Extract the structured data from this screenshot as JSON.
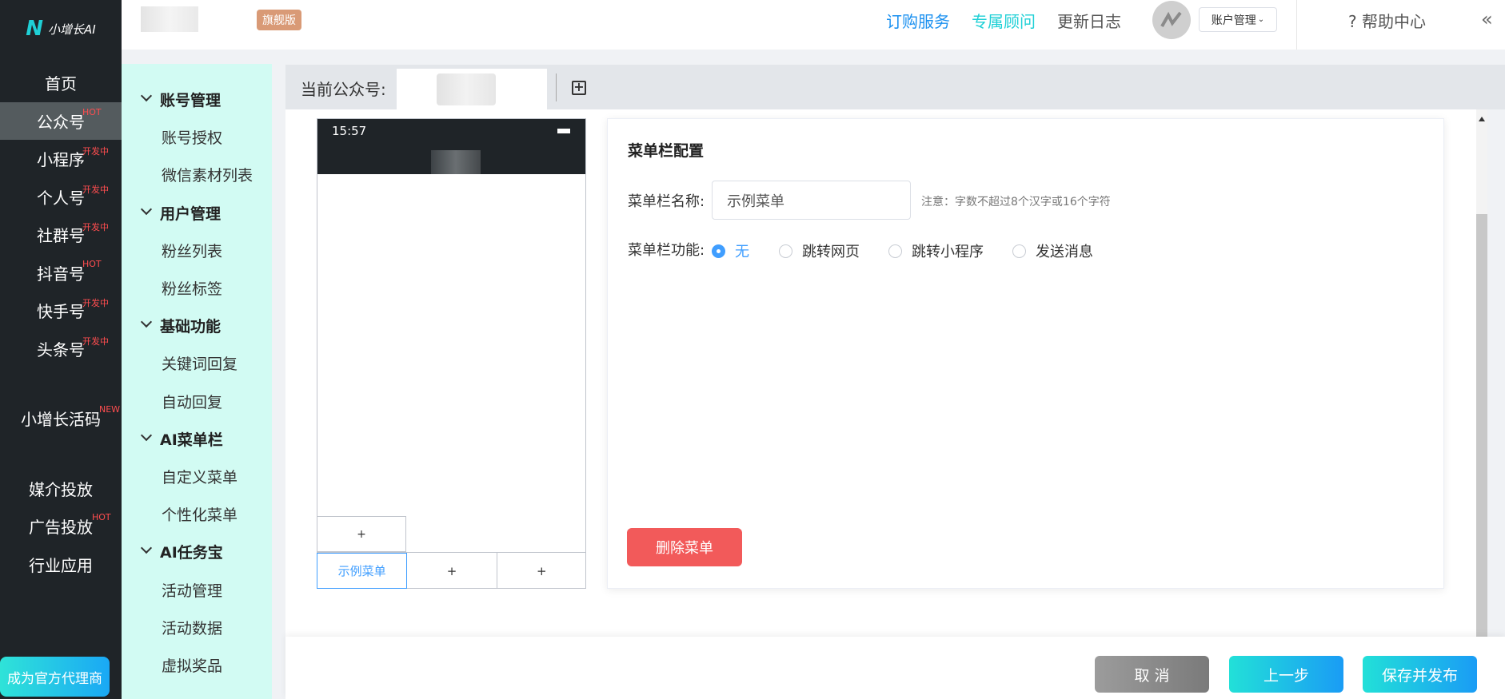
{
  "brand": {
    "logo_text": "小增长AI"
  },
  "sidebar": {
    "items": [
      {
        "label": "首页",
        "tag": ""
      },
      {
        "label": "公众号",
        "tag": "HOT"
      },
      {
        "label": "小程序",
        "tag": "开发中"
      },
      {
        "label": "个人号",
        "tag": "开发中"
      },
      {
        "label": "社群号",
        "tag": "开发中"
      },
      {
        "label": "抖音号",
        "tag": "HOT"
      },
      {
        "label": "快手号",
        "tag": "开发中"
      },
      {
        "label": "头条号",
        "tag": "开发中"
      }
    ],
    "live_code": {
      "label": "小增长活码",
      "tag": "NEW"
    },
    "extra": [
      {
        "label": "媒介投放",
        "tag": ""
      },
      {
        "label": "广告投放",
        "tag": "HOT"
      },
      {
        "label": "行业应用",
        "tag": ""
      }
    ],
    "agent_button": "成为官方代理商"
  },
  "header": {
    "edition_badge": "旗舰版",
    "links": {
      "subscribe": "订购服务",
      "advisor": "专属顾问",
      "changelog": "更新日志"
    },
    "account_menu": "账户管理",
    "help": "帮助中心",
    "collapse_icon": "«"
  },
  "submenu": {
    "groups": [
      {
        "title": "账号管理",
        "items": [
          "账号授权",
          "微信素材列表"
        ]
      },
      {
        "title": "用户管理",
        "items": [
          "粉丝列表",
          "粉丝标签"
        ]
      },
      {
        "title": "基础功能",
        "items": [
          "关键词回复",
          "自动回复"
        ]
      },
      {
        "title": "AI菜单栏",
        "items": [
          "自定义菜单",
          "个性化菜单"
        ]
      },
      {
        "title": "AI任务宝",
        "items": [
          "活动管理",
          "活动数据",
          "虚拟奖品"
        ]
      }
    ]
  },
  "account_bar": {
    "label": "当前公众号:"
  },
  "phone": {
    "time": "15:57",
    "sub_add": "+",
    "menus": [
      "示例菜单",
      "+",
      "+"
    ]
  },
  "config": {
    "title": "菜单栏配置",
    "name_label": "菜单栏名称:",
    "name_value": "示例菜单",
    "note": "注意：字数不超过8个汉字或16个字符",
    "func_label": "菜单栏功能:",
    "options": [
      "无",
      "跳转网页",
      "跳转小程序",
      "发送消息"
    ],
    "selected": "无",
    "delete_button": "删除菜单"
  },
  "footer": {
    "cancel": "取 消",
    "prev": "上一步",
    "save": "保存并发布"
  },
  "colors": {
    "accent": "#409eff",
    "teal": "#1fd0d6",
    "danger": "#f25a5a",
    "sidebar_bg": "#1f2428",
    "submenu_bg": "#d2fbf3"
  }
}
